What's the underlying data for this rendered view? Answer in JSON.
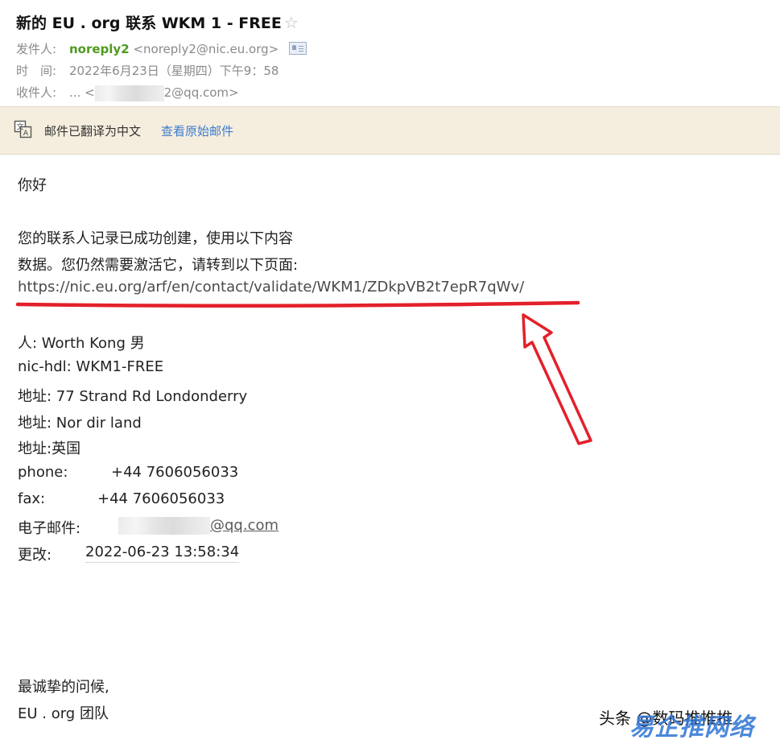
{
  "email": {
    "subject": "新的 EU . org 联系 WKM 1 - FREE",
    "star_icon": "star-outline-icon",
    "from_label": "发件人:",
    "sender_name": "noreply2",
    "sender_address": "<noreply2@nic.eu.org>",
    "time_label": "时　间:",
    "time_value": "2022年6月23日（星期四）下午9：58",
    "to_label": "收件人:",
    "to_prefix": "... <",
    "to_suffix": "2@qq.com>"
  },
  "translate_bar": {
    "icon": "translate-icon",
    "notice": "邮件已翻译为中文",
    "link": "查看原始邮件"
  },
  "body": {
    "greeting": "你好",
    "intro_line1": "您的联系人记录已成功创建，使用以下内容",
    "intro_line2": "数据。您仍然需要激活它，请转到以下页面:",
    "url": "https://nic.eu.org/arf/en/contact/validate/WKM1/ZDkpVB2t7epR7qWv/",
    "fields": {
      "person": "人: Worth Kong 男",
      "nic_hdl": "nic-hdl: WKM1-FREE",
      "address1": "地址: 77 Strand Rd Londonderry",
      "address2": "地址: Nor dir land",
      "address3": "地址:英国",
      "phone_label": "phone:",
      "phone_value": "+44 7606056033",
      "fax_label": "fax:",
      "fax_value": "+44 7606056033",
      "email_label": "电子邮件:",
      "email_suffix": "@qq.com",
      "changed_label": "更改:",
      "changed_value": "2022-06-23 13:58:34"
    },
    "closing": "最诚挚的问候,",
    "signature": "EU . org 团队"
  },
  "watermark": {
    "text": "头条 @数码推推推",
    "logo": "易企推网络"
  },
  "colors": {
    "sender_green": "#4f9a1f",
    "link_blue": "#3d7bd0",
    "translate_bar_bg": "#f5eede",
    "annotation_red": "#e3202a"
  }
}
